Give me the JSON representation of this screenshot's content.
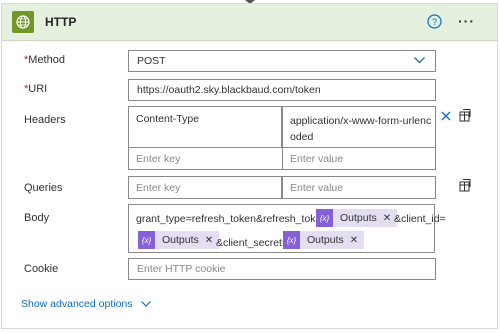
{
  "action": {
    "title": "HTTP",
    "colors": {
      "header_bg": "#e5f0df",
      "icon_bg": "#709727",
      "link": "#0f6cbd",
      "token_icon": "#8660d8",
      "token_bg": "#e5def3",
      "required": "#a4262c"
    },
    "help_icon": "question-circle-icon",
    "more_icon": "more-dots-icon",
    "more_text": "···"
  },
  "fields": {
    "required_mark": "*",
    "method": {
      "label": "Method",
      "value": "POST"
    },
    "uri": {
      "label": "URI",
      "value": "https://oauth2.sky.blackbaud.com/token"
    },
    "headers": {
      "label": "Headers",
      "rows": [
        {
          "key": "Content-Type",
          "value_line1": "application/x-www-form-urlenc",
          "value_line2": "oded"
        }
      ],
      "key_placeholder": "Enter key",
      "value_placeholder": "Enter value"
    },
    "queries": {
      "label": "Queries",
      "key_placeholder": "Enter key",
      "value_placeholder": "Enter value"
    },
    "body": {
      "label": "Body",
      "text1": "grant_type=refresh_token&refresh_token=",
      "text2": "&client_id=",
      "text3": "&client_secret=",
      "token_label": "Outputs",
      "token_icon_text": "{x}",
      "token_close": "✕"
    },
    "cookie": {
      "label": "Cookie",
      "placeholder": "Enter HTTP cookie"
    }
  },
  "footer": {
    "advanced_label": "Show advanced options"
  }
}
